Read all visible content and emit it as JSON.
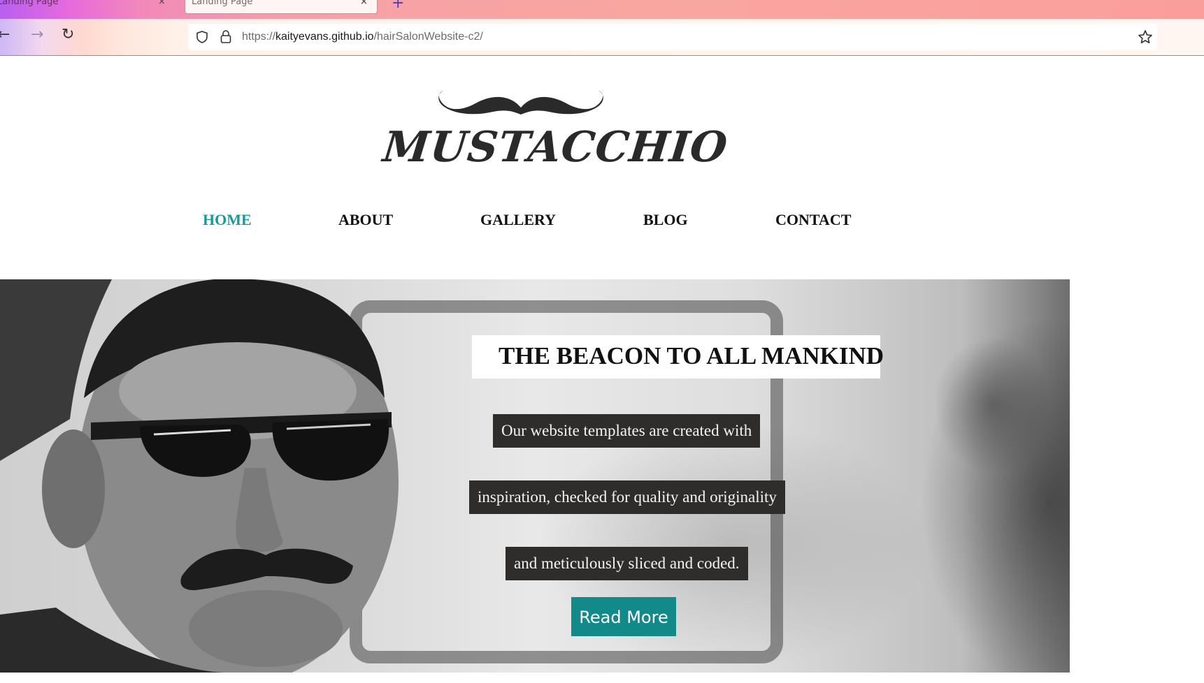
{
  "browser": {
    "tabs": [
      {
        "title": "Landing Page",
        "close": "×"
      },
      {
        "title": "Landing Page",
        "close": "×"
      }
    ],
    "new_tab": "+",
    "nav": {
      "back": "←",
      "forward": "→",
      "reload": "↻"
    },
    "url_prefix": "https://",
    "url_domain": "kaityevans.github.io",
    "url_path": "/hairSalonWebsite-c2/"
  },
  "site": {
    "logo_text": "MUSTACCHIO",
    "menu": [
      {
        "label": "HOME",
        "active": true
      },
      {
        "label": "ABOUT",
        "active": false
      },
      {
        "label": "GALLERY",
        "active": false
      },
      {
        "label": "BLOG",
        "active": false
      },
      {
        "label": "CONTACT",
        "active": false
      }
    ],
    "accent_color": "#179a9a"
  },
  "hero": {
    "title": "THE BEACON TO ALL MANKIND",
    "lines": [
      "Our website templates are created with",
      "inspiration, checked for quality and originality",
      "and meticulously sliced and coded."
    ],
    "button": "Read More"
  }
}
